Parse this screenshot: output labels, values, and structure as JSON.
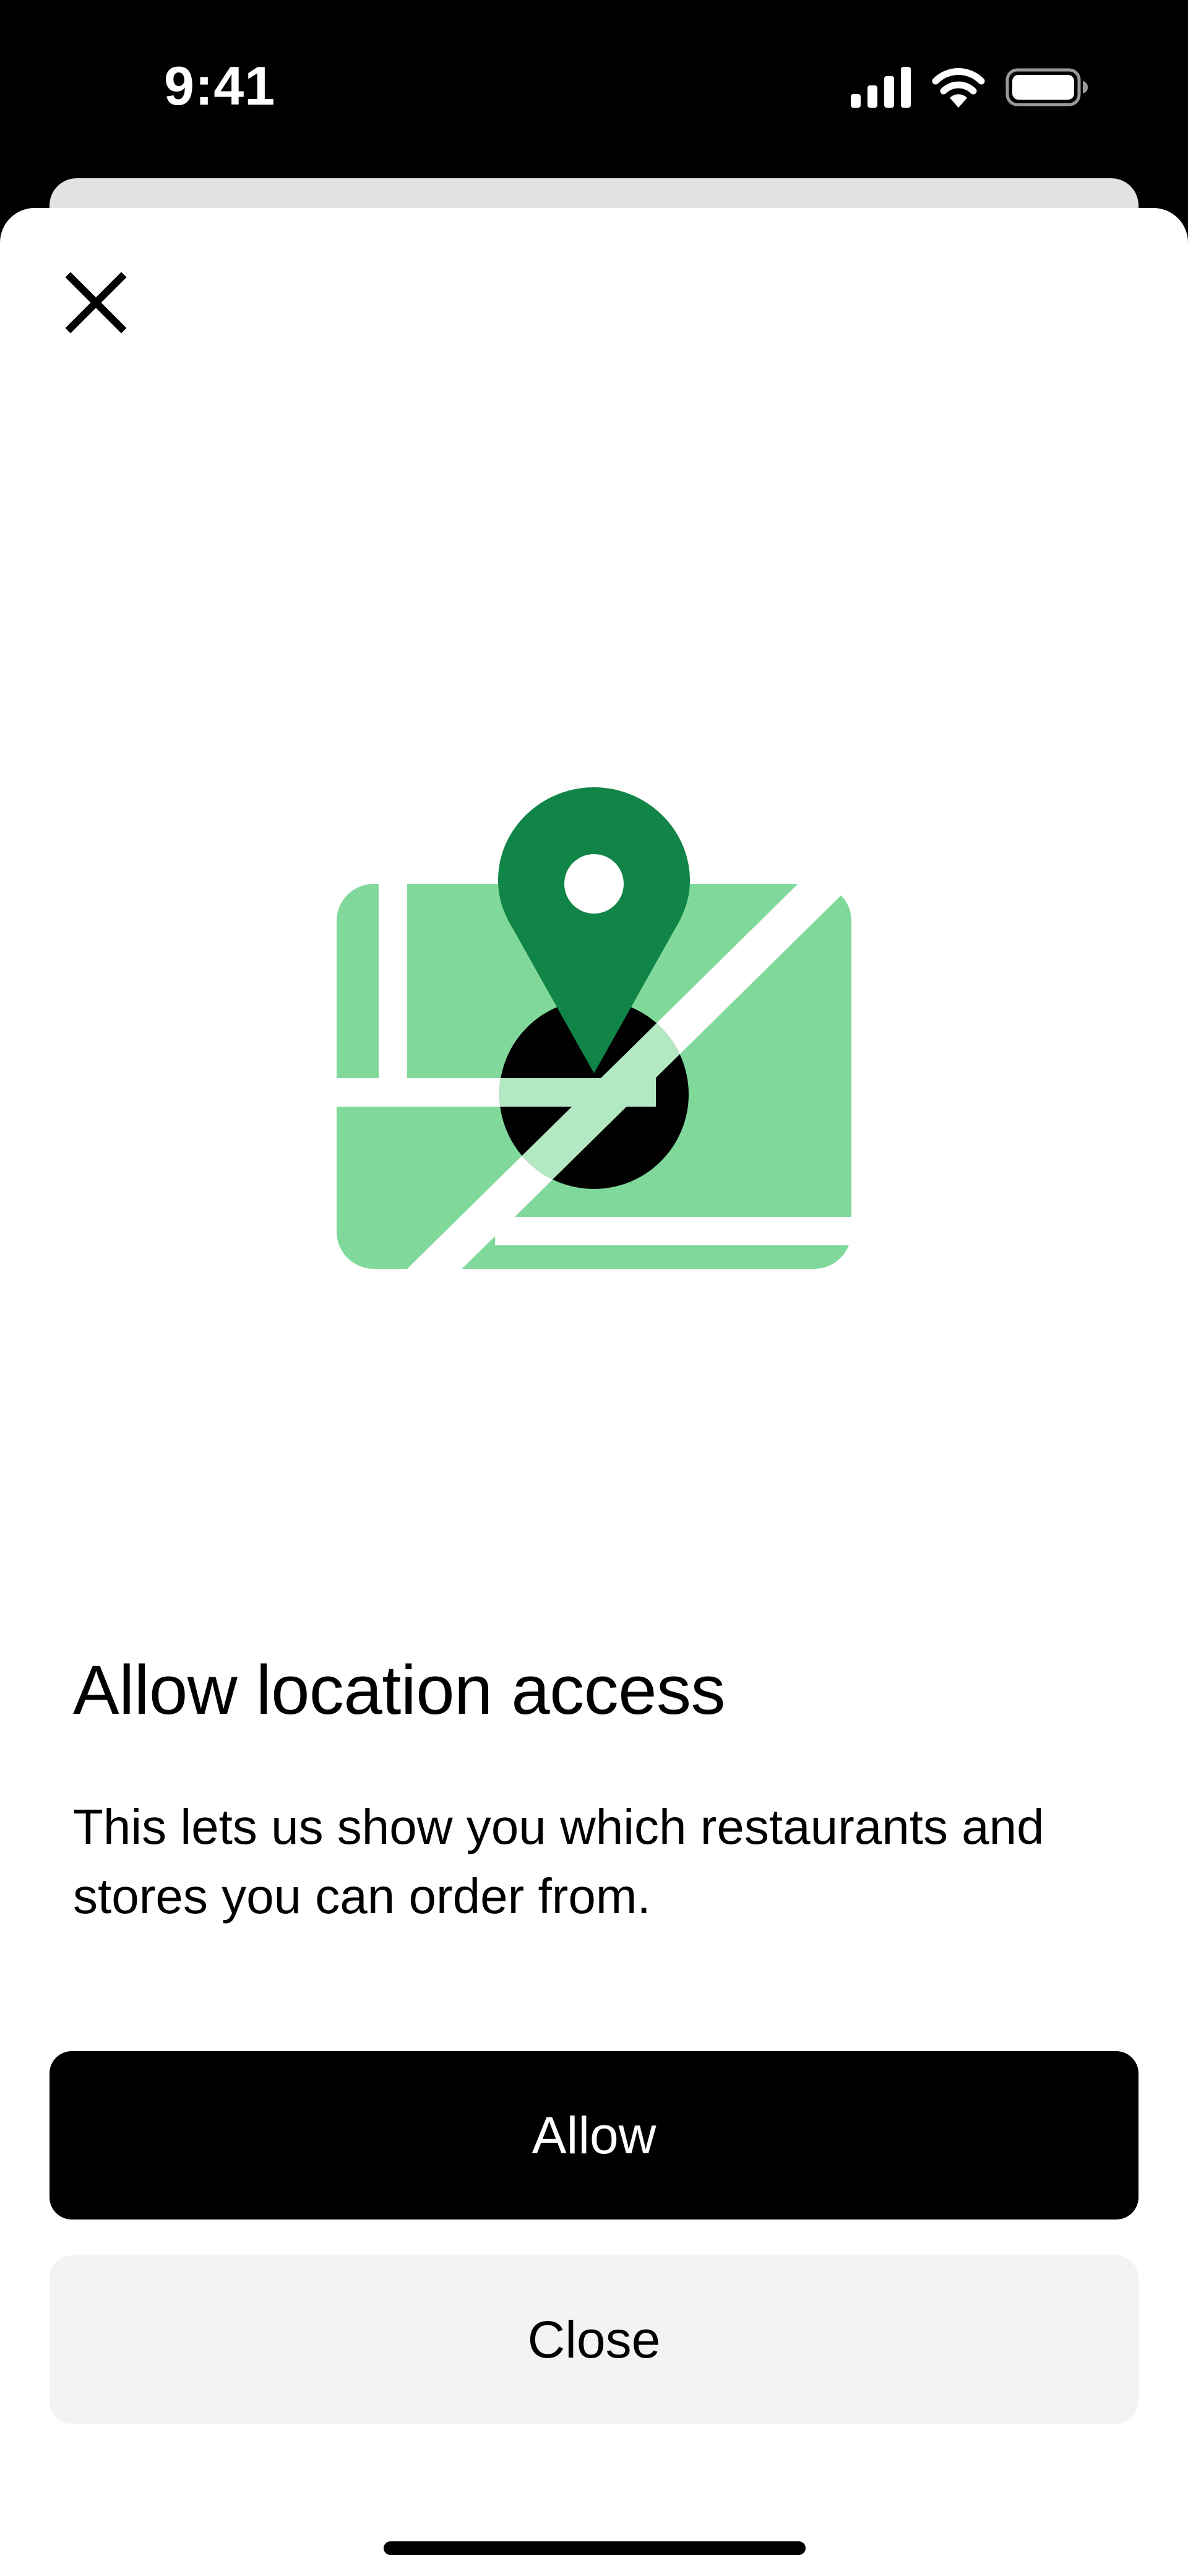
{
  "status_bar": {
    "time": "9:41",
    "signal_icon": "cellular-signal-icon",
    "wifi_icon": "wifi-icon",
    "battery_icon": "battery-full-icon"
  },
  "sheet": {
    "close_icon": "close-icon",
    "illustration_icon": "map-location-pin-icon",
    "title": "Allow location access",
    "description": "This lets us show you which restaurants and stores you can order from.",
    "primary_button_label": "Allow",
    "secondary_button_label": "Close"
  },
  "colors": {
    "map_fill": "#80d99b",
    "pin": "#118447",
    "road_overlap": "#b3e9c2",
    "primary_button": "#000000",
    "secondary_button": "#f3f3f3"
  }
}
